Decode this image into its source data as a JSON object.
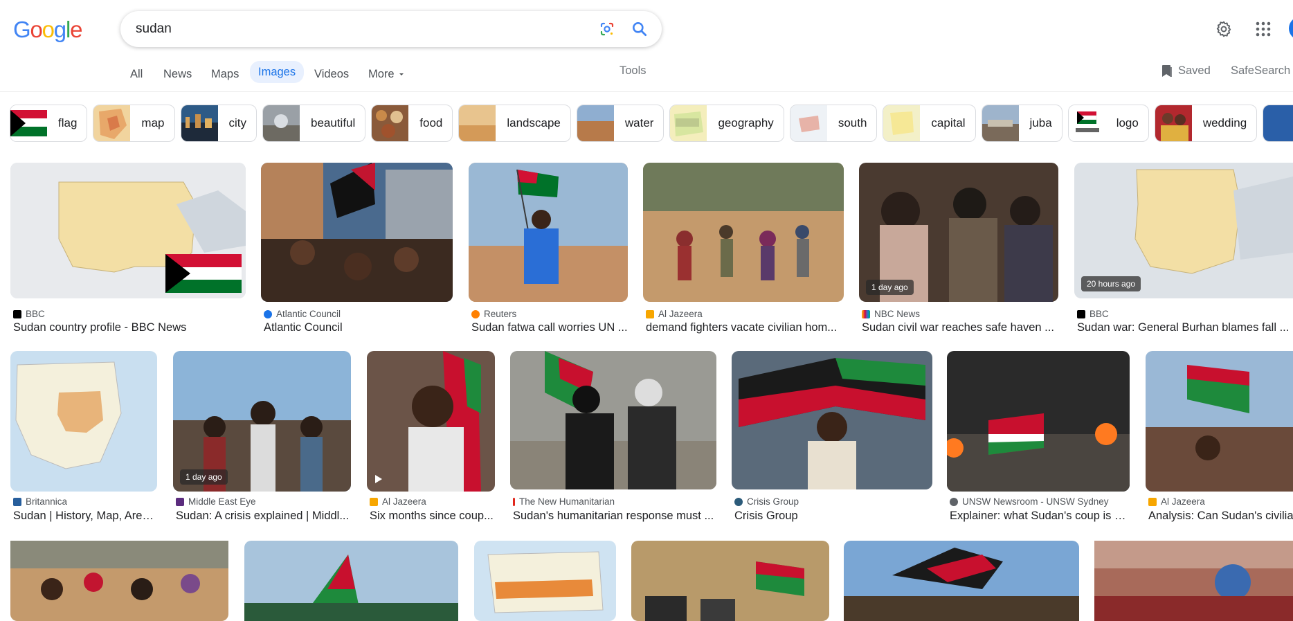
{
  "logo": {
    "letters": [
      "G",
      "o",
      "o",
      "g",
      "l",
      "e"
    ],
    "colors": [
      "#4285f4",
      "#ea4335",
      "#fbbc05",
      "#4285f4",
      "#34a853",
      "#ea4335"
    ]
  },
  "search": {
    "value": "sudan"
  },
  "tabs": [
    {
      "label": "All",
      "active": false
    },
    {
      "label": "News",
      "active": false
    },
    {
      "label": "Maps",
      "active": false
    },
    {
      "label": "Images",
      "active": true
    },
    {
      "label": "Videos",
      "active": false
    },
    {
      "label": "More",
      "active": false
    }
  ],
  "tools_label": "Tools",
  "saved_label": "Saved",
  "safesearch_label": "SafeSearch",
  "chips": [
    {
      "label": "flag"
    },
    {
      "label": "map"
    },
    {
      "label": "city"
    },
    {
      "label": "beautiful"
    },
    {
      "label": "food"
    },
    {
      "label": "landscape"
    },
    {
      "label": "water"
    },
    {
      "label": "geography"
    },
    {
      "label": "south"
    },
    {
      "label": "capital"
    },
    {
      "label": "juba"
    },
    {
      "label": "logo"
    },
    {
      "label": "wedding"
    }
  ],
  "results": [
    {
      "source": "BBC",
      "title": "Sudan country profile - BBC News",
      "badge": "",
      "icon": "bbc-icon",
      "favicon_color": "#000000"
    },
    {
      "source": "Atlantic Council",
      "title": "Atlantic Council",
      "badge": "",
      "icon": "globe-icon",
      "favicon_color": "#1a73e8"
    },
    {
      "source": "Reuters",
      "title": "Sudan fatwa call worries UN ...",
      "badge": "",
      "icon": "reuters-icon",
      "favicon_color": "#ff8000"
    },
    {
      "source": "Al Jazeera",
      "title": "demand fighters vacate civilian hom...",
      "badge": "",
      "icon": "aljazeera-icon",
      "favicon_color": "#f7a600"
    },
    {
      "source": "NBC News",
      "title": "Sudan civil war reaches safe haven ...",
      "badge": "1 day ago",
      "icon": "nbc-icon",
      "favicon_color": "#6460aa"
    },
    {
      "source": "BBC",
      "title": "Sudan war: General Burhan blames fall ...",
      "badge": "20 hours ago",
      "icon": "bbc-icon",
      "favicon_color": "#000000"
    },
    {
      "source": "Britannica",
      "title": "Sudan | History, Map, Area,...",
      "badge": "",
      "icon": "britannica-icon",
      "favicon_color": "#275e9c"
    },
    {
      "source": "Middle East Eye",
      "title": "Sudan: A crisis explained | Middl...",
      "badge": "1 day ago",
      "icon": "mee-icon",
      "favicon_color": "#5b2c7e"
    },
    {
      "source": "Al Jazeera",
      "title": "Six months since coup...",
      "badge": "",
      "icon": "aljazeera-icon",
      "favicon_color": "#f7a600"
    },
    {
      "source": "The New Humanitarian",
      "title": "Sudan's humanitarian response must ...",
      "badge": "",
      "icon": "tnh-icon",
      "favicon_color": "#e1261c"
    },
    {
      "source": "Crisis Group",
      "title": "Crisis Group",
      "badge": "",
      "icon": "crisisgroup-icon",
      "favicon_color": "#2c5b7a"
    },
    {
      "source": "UNSW Newsroom - UNSW Sydney",
      "title": "Explainer: what Sudan's coup is a...",
      "badge": "",
      "icon": "globe-icon",
      "favicon_color": "#5f6368"
    },
    {
      "source": "Al Jazeera",
      "title": "Analysis: Can Sudan's civilian",
      "badge": "",
      "icon": "aljazeera-icon",
      "favicon_color": "#f7a600"
    }
  ]
}
